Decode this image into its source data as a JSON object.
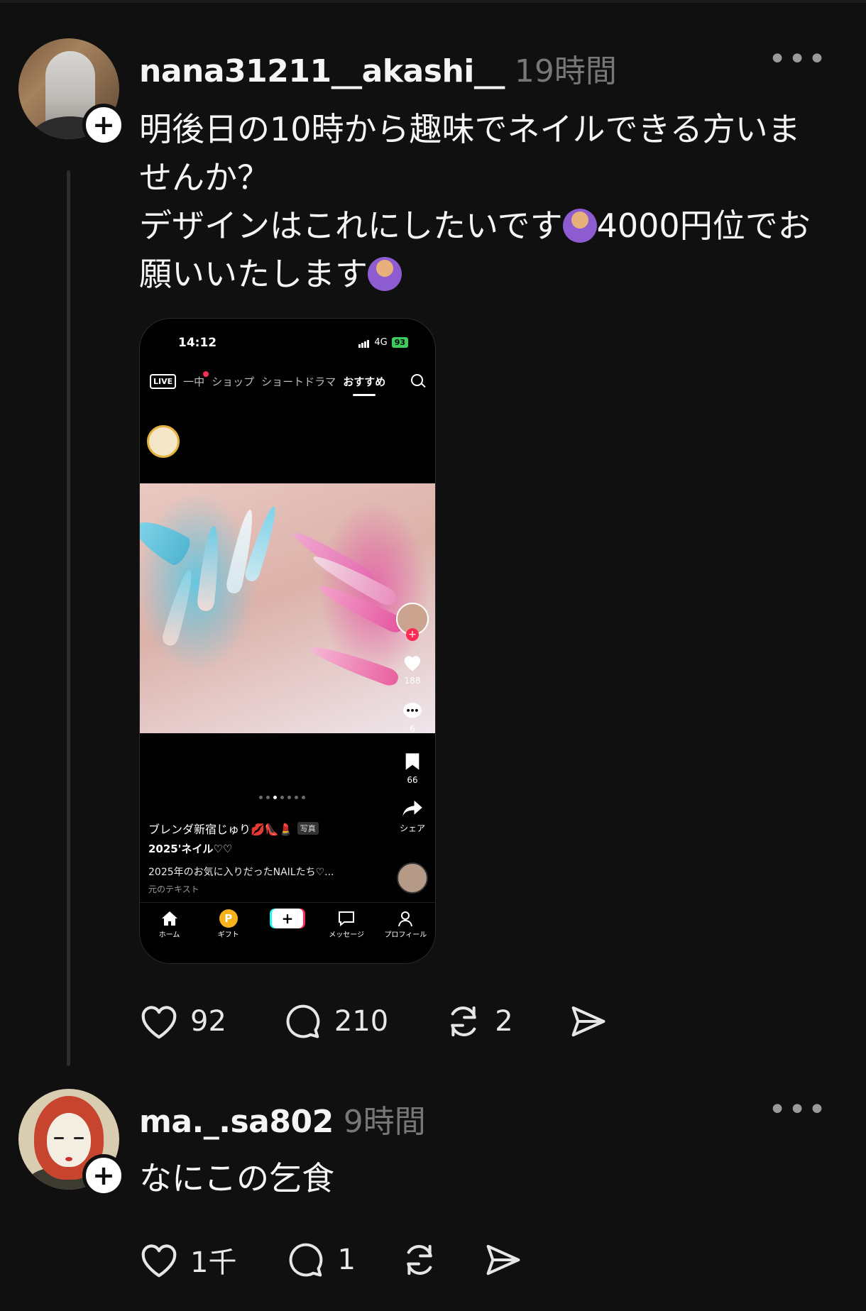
{
  "posts": [
    {
      "username": "nana31211__akashi__",
      "time": "19時間",
      "text_line1": "明後日の10時から趣味でネイルできる方いま",
      "text_line2": "せんか？",
      "text_line3a": "デザインはこれにしたいです",
      "text_line3b": "4000円位でお",
      "text_line4": "願いいたします",
      "likes": "92",
      "comments": "210",
      "reposts": "2"
    },
    {
      "username": "ma._.sa802",
      "time": "9時間",
      "text": "なにこの乞食",
      "likes": "1千",
      "comments": "1",
      "reposts": ""
    }
  ],
  "embedded_screenshot": {
    "status_time": "14:12",
    "network": "4G",
    "battery": "93",
    "tabs": [
      "LIVE",
      "一中",
      "ショップ",
      "ショートドラマ",
      "おすすめ"
    ],
    "active_tab": "おすすめ",
    "side": {
      "likes": "188",
      "comments": "6",
      "saves": "66",
      "share": "シェア"
    },
    "caption_user": "ブレンダ新宿じゅり💋👠💄",
    "caption_tag": "写真",
    "caption_title": "2025'ネイル♡♡",
    "caption_desc": "2025年のお気に入りだったNAILたち♡...",
    "caption_orig": "元のテキスト",
    "nav": [
      "ホーム",
      "ギフト",
      "",
      "メッセージ",
      "プロフィール"
    ]
  },
  "icons": [
    "plus-icon",
    "more-icon",
    "heart-icon",
    "comment-icon",
    "repost-icon",
    "share-icon"
  ]
}
